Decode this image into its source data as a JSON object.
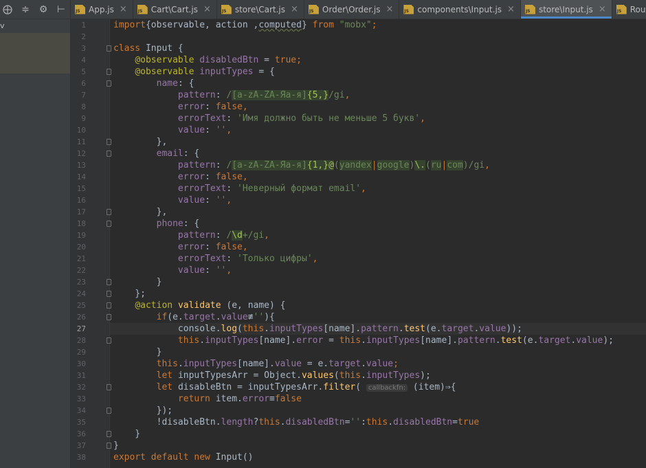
{
  "left_panel": {
    "toolbar_icons": [
      "target-icon",
      "collapse-icon",
      "gear-icon",
      "hide-icon"
    ],
    "partial_text": "v"
  },
  "tabs": [
    {
      "label": "App.js",
      "active": false
    },
    {
      "label": "Cart\\Cart.js",
      "active": false
    },
    {
      "label": "store\\Cart.js",
      "active": false
    },
    {
      "label": "Order\\Order.js",
      "active": false
    },
    {
      "label": "components\\Input.js",
      "active": false
    },
    {
      "label": "store\\Input.js",
      "active": true
    },
    {
      "label": "Router.js",
      "active": false
    }
  ],
  "editor": {
    "current_line": 27,
    "lines": [
      [
        [
          "kw",
          "import"
        ],
        [
          "",
          "{observable, action ,"
        ],
        [
          "weak",
          "computed"
        ],
        [
          "",
          "} "
        ],
        [
          "kw",
          "from"
        ],
        [
          "str",
          " \"mobx\""
        ],
        [
          "kw",
          ";"
        ]
      ],
      [],
      [
        [
          "kw",
          "class "
        ],
        [
          "",
          "Input {"
        ]
      ],
      [
        [
          "",
          "    "
        ],
        [
          "anno",
          "@observable "
        ],
        [
          "prop",
          "disabledBtn"
        ],
        [
          "",
          " = "
        ],
        [
          "kw",
          "true;"
        ]
      ],
      [
        [
          "",
          "    "
        ],
        [
          "anno",
          "@observable "
        ],
        [
          "prop",
          "inputTypes"
        ],
        [
          "",
          " = {"
        ]
      ],
      [
        [
          "",
          "        "
        ],
        [
          "prop",
          "name"
        ],
        [
          "",
          ": {"
        ]
      ],
      [
        [
          "",
          "            "
        ],
        [
          "prop",
          "pattern"
        ],
        [
          "",
          ": "
        ],
        [
          "rx",
          "/"
        ],
        [
          "rxhl",
          "[a-zA-ZA-Яа-я]"
        ],
        [
          "rxbr",
          "{5,}"
        ],
        [
          "rx",
          "/gi"
        ],
        [
          "kw",
          ","
        ]
      ],
      [
        [
          "",
          "            "
        ],
        [
          "prop",
          "error"
        ],
        [
          "",
          ": "
        ],
        [
          "kw",
          "false,"
        ]
      ],
      [
        [
          "",
          "            "
        ],
        [
          "prop",
          "errorText"
        ],
        [
          "",
          ": "
        ],
        [
          "str",
          "'Имя должно быть не меньше 5 букв'"
        ],
        [
          "kw",
          ","
        ]
      ],
      [
        [
          "",
          "            "
        ],
        [
          "prop",
          "value"
        ],
        [
          "",
          ": "
        ],
        [
          "str",
          "''"
        ],
        [
          "kw",
          ","
        ]
      ],
      [
        [
          "",
          "        },"
        ]
      ],
      [
        [
          "",
          "        "
        ],
        [
          "prop",
          "email"
        ],
        [
          "",
          ": {"
        ]
      ],
      [
        [
          "",
          "            "
        ],
        [
          "prop",
          "pattern"
        ],
        [
          "",
          ": "
        ],
        [
          "rx",
          "/"
        ],
        [
          "rxhl",
          "[a-zA-ZA-Яа-я]"
        ],
        [
          "rxbr",
          "{1,}"
        ],
        [
          "rxbr",
          "@"
        ],
        [
          "rx",
          "("
        ],
        [
          "rxhl",
          "yandex"
        ],
        [
          "rxor",
          "|"
        ],
        [
          "rxhl",
          "google"
        ],
        [
          "rx",
          ")"
        ],
        [
          "rxbr",
          "\\."
        ],
        [
          "rx",
          "("
        ],
        [
          "rxhl",
          "ru"
        ],
        [
          "rxor",
          "|"
        ],
        [
          "rxhl",
          "com"
        ],
        [
          "rx",
          ")/gi"
        ],
        [
          "kw",
          ","
        ]
      ],
      [
        [
          "",
          "            "
        ],
        [
          "prop",
          "error"
        ],
        [
          "",
          ": "
        ],
        [
          "kw",
          "false,"
        ]
      ],
      [
        [
          "",
          "            "
        ],
        [
          "prop",
          "errorText"
        ],
        [
          "",
          ": "
        ],
        [
          "str",
          "'Неверный формат email'"
        ],
        [
          "kw",
          ","
        ]
      ],
      [
        [
          "",
          "            "
        ],
        [
          "prop",
          "value"
        ],
        [
          "",
          ": "
        ],
        [
          "str",
          "''"
        ],
        [
          "kw",
          ","
        ]
      ],
      [
        [
          "",
          "        },"
        ]
      ],
      [
        [
          "",
          "        "
        ],
        [
          "prop",
          "phone"
        ],
        [
          "",
          ": {"
        ]
      ],
      [
        [
          "",
          "            "
        ],
        [
          "prop",
          "pattern"
        ],
        [
          "",
          ": "
        ],
        [
          "rx",
          "/"
        ],
        [
          "rxbr",
          "\\d"
        ],
        [
          "rx",
          "+/gi"
        ],
        [
          "kw",
          ","
        ]
      ],
      [
        [
          "",
          "            "
        ],
        [
          "prop",
          "error"
        ],
        [
          "",
          ": "
        ],
        [
          "kw",
          "false,"
        ]
      ],
      [
        [
          "",
          "            "
        ],
        [
          "prop",
          "errorText"
        ],
        [
          "",
          ": "
        ],
        [
          "str",
          "'Только цифры'"
        ],
        [
          "kw",
          ","
        ]
      ],
      [
        [
          "",
          "            "
        ],
        [
          "prop",
          "value"
        ],
        [
          "",
          ": "
        ],
        [
          "str",
          "''"
        ],
        [
          "kw",
          ","
        ]
      ],
      [
        [
          "",
          "        }"
        ]
      ],
      [
        [
          "",
          "    };"
        ]
      ],
      [
        [
          "",
          "    "
        ],
        [
          "anno",
          "@action "
        ],
        [
          "fn",
          "validate "
        ],
        [
          "",
          "(e, name) {"
        ]
      ],
      [
        [
          "",
          "        "
        ],
        [
          "kw",
          "if"
        ],
        [
          "",
          "(e."
        ],
        [
          "prop",
          "target"
        ],
        [
          "",
          "."
        ],
        [
          "prop",
          "value"
        ],
        [
          "",
          "≢"
        ],
        [
          "str",
          "''"
        ],
        [
          "",
          "){"
        ]
      ],
      [
        [
          "",
          "            console."
        ],
        [
          "fn",
          "log"
        ],
        [
          "",
          "("
        ],
        [
          "kw",
          "this"
        ],
        [
          "",
          "."
        ],
        [
          "prop",
          "inputTypes"
        ],
        [
          "",
          "[name]."
        ],
        [
          "prop",
          "pattern"
        ],
        [
          "",
          "."
        ],
        [
          "fn",
          "test"
        ],
        [
          "",
          "(e."
        ],
        [
          "prop",
          "target"
        ],
        [
          "",
          "."
        ],
        [
          "prop",
          "value"
        ],
        [
          "",
          "));"
        ]
      ],
      [
        [
          "",
          "            "
        ],
        [
          "kw",
          "this"
        ],
        [
          "",
          "."
        ],
        [
          "prop",
          "inputTypes"
        ],
        [
          "",
          "[name]."
        ],
        [
          "prop",
          "error"
        ],
        [
          "",
          " = "
        ],
        [
          "kw",
          "this"
        ],
        [
          "",
          "."
        ],
        [
          "prop",
          "inputTypes"
        ],
        [
          "",
          "[name]."
        ],
        [
          "prop",
          "pattern"
        ],
        [
          "",
          "."
        ],
        [
          "fn",
          "test"
        ],
        [
          "",
          "(e."
        ],
        [
          "prop",
          "target"
        ],
        [
          "",
          "."
        ],
        [
          "prop",
          "value"
        ],
        [
          "",
          ");"
        ]
      ],
      [
        [
          "",
          "        }"
        ]
      ],
      [
        [
          "",
          "        "
        ],
        [
          "kw",
          "this"
        ],
        [
          "",
          "."
        ],
        [
          "prop",
          "inputTypes"
        ],
        [
          "",
          "[name]."
        ],
        [
          "prop",
          "value"
        ],
        [
          "",
          " = e."
        ],
        [
          "prop",
          "target"
        ],
        [
          "",
          "."
        ],
        [
          "prop",
          "value"
        ],
        [
          "kw",
          ";"
        ]
      ],
      [
        [
          "",
          "        "
        ],
        [
          "kw",
          "let "
        ],
        [
          "",
          "inputTypesArr = Object."
        ],
        [
          "fn",
          "values"
        ],
        [
          "",
          "("
        ],
        [
          "kw",
          "this"
        ],
        [
          "",
          "."
        ],
        [
          "prop",
          "inputTypes"
        ],
        [
          "",
          ");"
        ]
      ],
      [
        [
          "",
          "        "
        ],
        [
          "kw",
          "let "
        ],
        [
          "",
          "disableBtn = inputTypesArr."
        ],
        [
          "fn",
          "filter"
        ],
        [
          "",
          "( "
        ],
        [
          "hint",
          "callbackfn:"
        ],
        [
          "",
          " (item)⇒{"
        ]
      ],
      [
        [
          "",
          "            "
        ],
        [
          "kw",
          "return "
        ],
        [
          "",
          "item."
        ],
        [
          "prop",
          "error"
        ],
        [
          "",
          "≡"
        ],
        [
          "kw",
          "false"
        ]
      ],
      [
        [
          "",
          "        });"
        ]
      ],
      [
        [
          "",
          "        !disableBtn."
        ],
        [
          "prop",
          "length"
        ],
        [
          "",
          "?"
        ],
        [
          "kw",
          "this"
        ],
        [
          "",
          "."
        ],
        [
          "prop",
          "disabledBtn"
        ],
        [
          "",
          "="
        ],
        [
          "str",
          "''"
        ],
        [
          "",
          ":"
        ],
        [
          "kw",
          "this"
        ],
        [
          "",
          "."
        ],
        [
          "prop",
          "disabledBtn"
        ],
        [
          "",
          "="
        ],
        [
          "kw",
          "true"
        ]
      ],
      [
        [
          "",
          "    }"
        ]
      ],
      [
        [
          "",
          "}"
        ]
      ],
      [
        [
          "kw",
          "export default new "
        ],
        [
          "",
          "Input()"
        ]
      ]
    ],
    "fold_markers": [
      3,
      5,
      6,
      11,
      12,
      17,
      18,
      23,
      24,
      25,
      26,
      28,
      32,
      34,
      36,
      37
    ]
  }
}
